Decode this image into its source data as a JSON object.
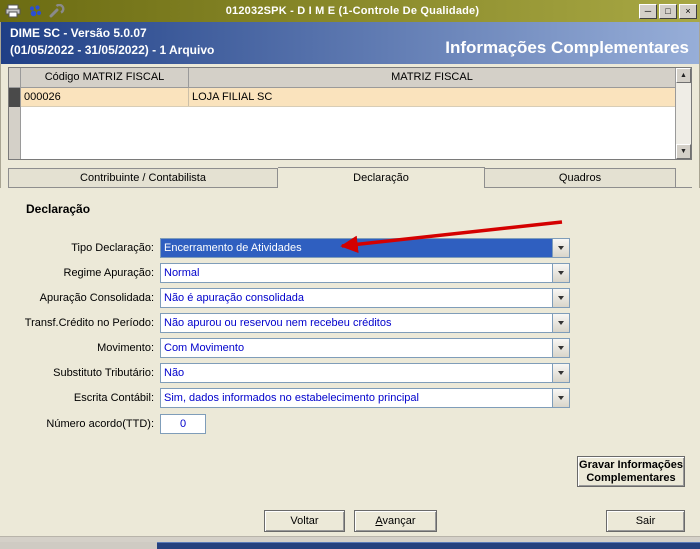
{
  "window": {
    "title": "012032SPK - D I M E (1-Controle De Qualidade)"
  },
  "icons": {
    "minimize": "─",
    "maximize": "□",
    "close": "×",
    "up": "▲",
    "down": "▼"
  },
  "header": {
    "line1": "DIME SC - Versão 5.0.07",
    "line2": "(01/05/2022 - 31/05/2022) - 1 Arquivo",
    "right_title": "Informações Complementares"
  },
  "grid": {
    "columns": [
      "Código MATRIZ FISCAL",
      "MATRIZ FISCAL"
    ],
    "rows": [
      {
        "codigo": "000026",
        "matriz": "LOJA FILIAL SC"
      }
    ]
  },
  "tabs": [
    {
      "label": "Contribuinte / Contabilista"
    },
    {
      "label": "Declaração"
    },
    {
      "label": "Quadros"
    }
  ],
  "form": {
    "group_title": "Declaração",
    "fields": [
      {
        "label": "Tipo Declaração:",
        "value": "Encerramento de Atividades"
      },
      {
        "label": "Regime Apuração:",
        "value": "Normal"
      },
      {
        "label": "Apuração Consolidada:",
        "value": "Não é apuração consolidada"
      },
      {
        "label": "Transf.Crédito no Período:",
        "value": "Não apurou ou reservou nem recebeu créditos"
      },
      {
        "label": "Movimento:",
        "value": "Com Movimento"
      },
      {
        "label": "Substituto Tributário:",
        "value": "Não"
      },
      {
        "label": "Escrita Contábil:",
        "value": "Sim, dados informados no estabelecimento principal"
      }
    ],
    "ttd": {
      "label": "Número acordo(TTD):",
      "value": "0"
    }
  },
  "buttons": {
    "gravar_line1": "Gravar Informações",
    "gravar_line2": "Complementares",
    "voltar": "Voltar",
    "avancar_hotkey": "A",
    "avancar_rest": "vançar",
    "sair": "Sair"
  },
  "colors": {
    "titlebar_olive": "#7d7d20",
    "header_blue": "#2a4d95",
    "selection_blue": "#2f5fc0",
    "value_blue": "#0000cc",
    "row_highlight": "#fae3bd",
    "annotation_red": "#d40000"
  }
}
